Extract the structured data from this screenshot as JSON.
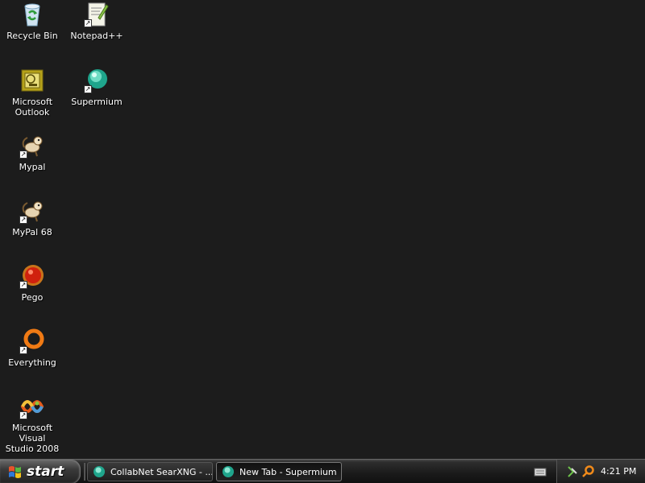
{
  "desktop": {
    "icons": [
      {
        "label": "Recycle Bin"
      },
      {
        "label": "Notepad++"
      },
      {
        "label": "Microsoft\nOutlook"
      },
      {
        "label": "Supermium"
      },
      {
        "label": "Mypal"
      },
      {
        "label": "MyPal 68"
      },
      {
        "label": "Pego"
      },
      {
        "label": "Everything"
      },
      {
        "label": "Microsoft Visual\nStudio 2008"
      }
    ]
  },
  "taskbar": {
    "start_label": "start",
    "tasks": [
      {
        "label": "CollabNet SearXNG - ..."
      },
      {
        "label": "New Tab - Supermium"
      }
    ],
    "clock": "4:21 PM"
  }
}
